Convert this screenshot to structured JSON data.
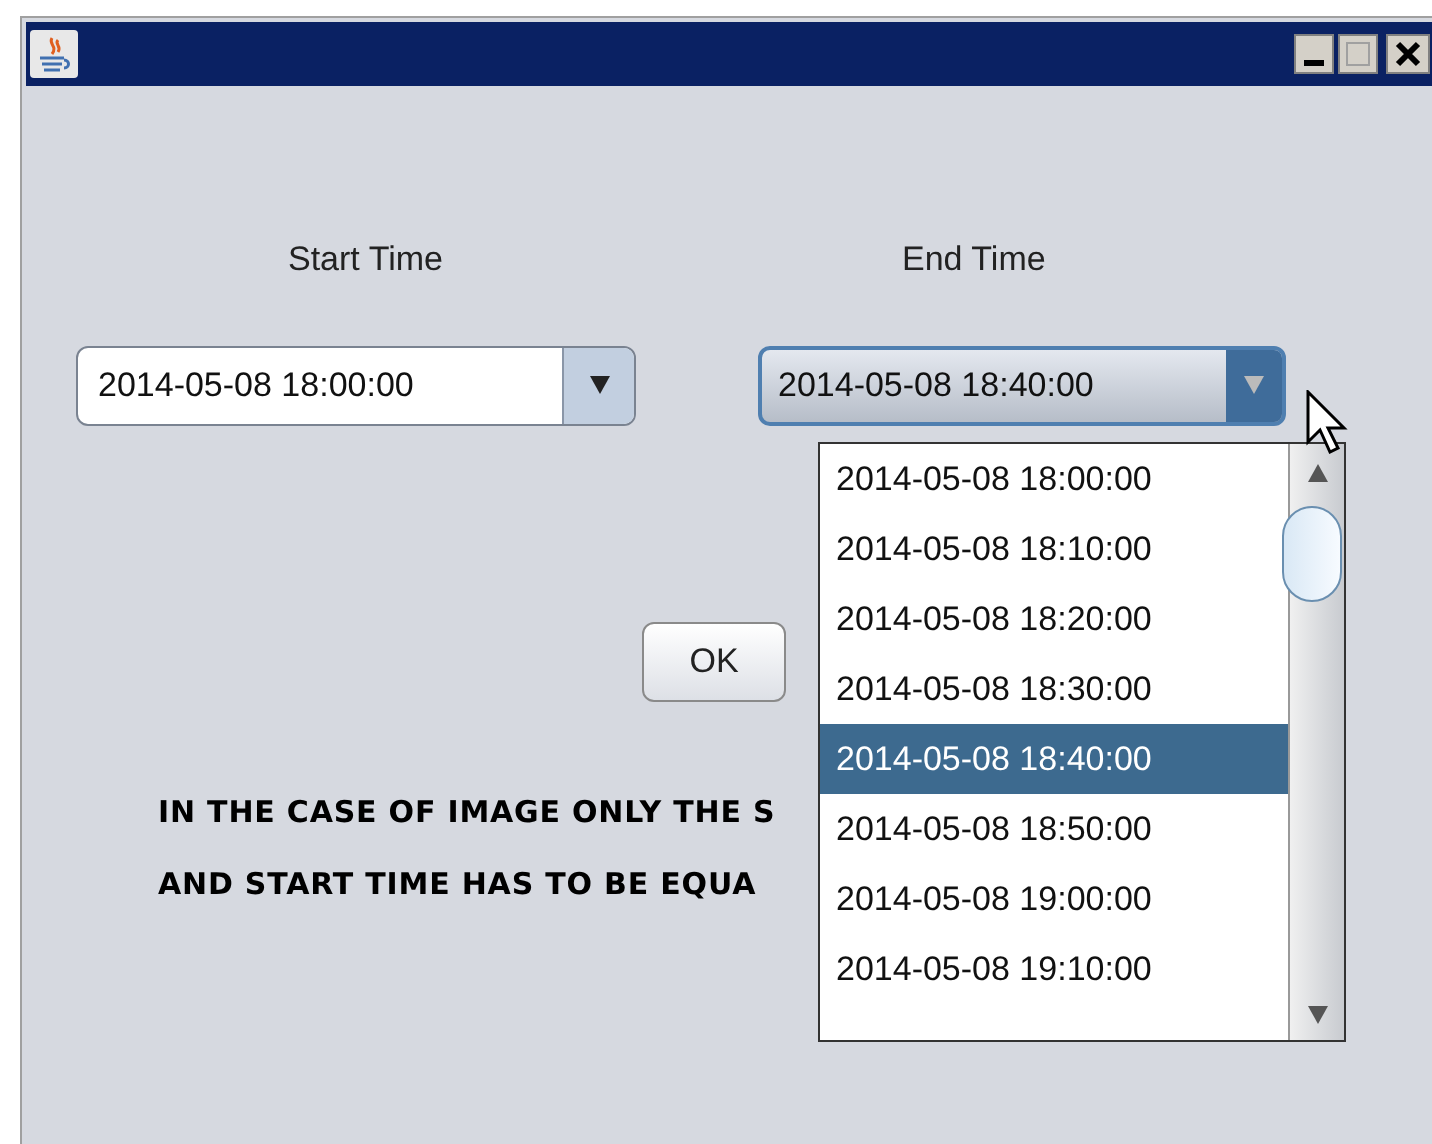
{
  "start_time": {
    "label": "Start Time",
    "value": "2014-05-08 18:00:00",
    "expanded": false
  },
  "end_time": {
    "label": "End Time",
    "value": "2014-05-08 18:40:00",
    "expanded": true
  },
  "end_time_options": [
    {
      "label": "2014-05-08 18:00:00",
      "selected": false
    },
    {
      "label": "2014-05-08 18:10:00",
      "selected": false
    },
    {
      "label": "2014-05-08 18:20:00",
      "selected": false
    },
    {
      "label": "2014-05-08 18:30:00",
      "selected": false
    },
    {
      "label": "2014-05-08 18:40:00",
      "selected": true
    },
    {
      "label": "2014-05-08 18:50:00",
      "selected": false
    },
    {
      "label": "2014-05-08 19:00:00",
      "selected": false
    },
    {
      "label": "2014-05-08 19:10:00",
      "selected": false
    }
  ],
  "ok_button": "OK",
  "note_lines": [
    "IN THE CASE OF IMAGE ONLY THE S",
    "AND START TIME HAS TO BE EQUA"
  ]
}
